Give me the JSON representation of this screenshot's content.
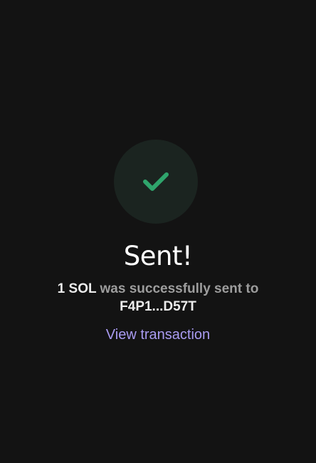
{
  "icon": "checkmark-icon",
  "colors": {
    "background": "#131313",
    "check_circle": "#1b2420",
    "check": "#2fa56c",
    "link": "#a99bf1",
    "muted_text": "#9d9d9d",
    "strong_text": "#ececec"
  },
  "status": {
    "title": "Sent!",
    "amount": "1 SOL",
    "message_middle": " was successfully sent to ",
    "recipient": "F4P1...D57T"
  },
  "actions": {
    "view_transaction_label": "View transaction"
  }
}
